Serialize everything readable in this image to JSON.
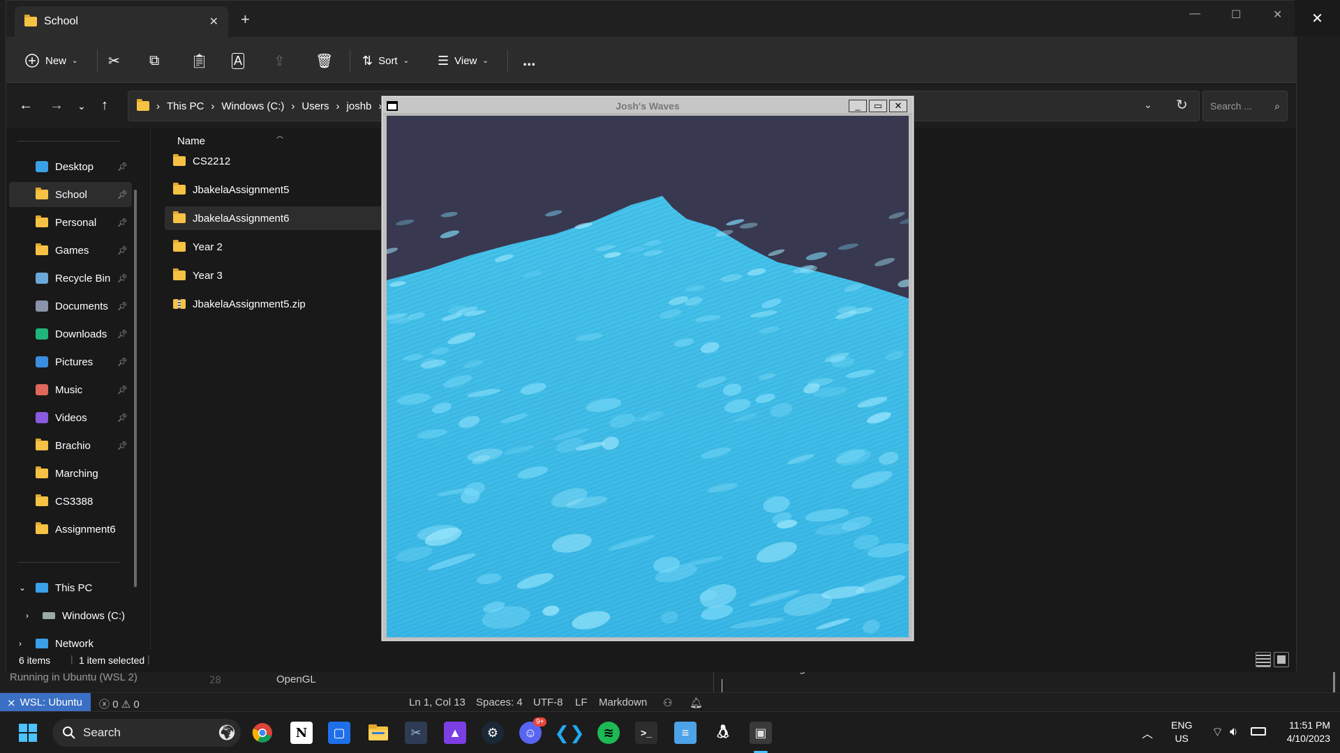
{
  "explorer": {
    "tab_title": "School",
    "toolbar": {
      "new_label": "New",
      "sort_label": "Sort",
      "view_label": "View",
      "more_label": "..."
    },
    "breadcrumb": [
      "This PC",
      "Windows (C:)",
      "Users",
      "joshb"
    ],
    "search_placeholder": "Search ...",
    "nav_items": [
      {
        "label": "Desktop",
        "icon": "desktop-icon",
        "pinned": true
      },
      {
        "label": "School",
        "icon": "folder-icon",
        "pinned": true,
        "selected": true
      },
      {
        "label": "Personal",
        "icon": "folder-icon",
        "pinned": true
      },
      {
        "label": "Games",
        "icon": "folder-icon",
        "pinned": true
      },
      {
        "label": "Recycle Bin",
        "icon": "recycle-bin-icon",
        "pinned": true
      },
      {
        "label": "Documents",
        "icon": "documents-icon",
        "pinned": true
      },
      {
        "label": "Downloads",
        "icon": "downloads-icon",
        "pinned": true
      },
      {
        "label": "Pictures",
        "icon": "pictures-icon",
        "pinned": true
      },
      {
        "label": "Music",
        "icon": "music-icon",
        "pinned": true
      },
      {
        "label": "Videos",
        "icon": "videos-icon",
        "pinned": true
      },
      {
        "label": "Brachio",
        "icon": "folder-icon",
        "pinned": true
      },
      {
        "label": "Marching",
        "icon": "folder-icon",
        "pinned": false
      },
      {
        "label": "CS3388",
        "icon": "folder-icon",
        "pinned": false
      },
      {
        "label": "Assignment6",
        "icon": "folder-icon",
        "pinned": false
      }
    ],
    "tree": {
      "this_pc": "This PC",
      "windows_c": "Windows (C:)",
      "network": "Network"
    },
    "column_name": "Name",
    "files": [
      {
        "name": "CS2212",
        "type": "folder"
      },
      {
        "name": "JbakelaAssignment5",
        "type": "folder"
      },
      {
        "name": "JbakelaAssignment6",
        "type": "folder",
        "selected": true
      },
      {
        "name": "Year 2",
        "type": "folder"
      },
      {
        "name": "Year 3",
        "type": "folder"
      },
      {
        "name": "JbakelaAssignment5.zip",
        "type": "zip"
      }
    ],
    "status": {
      "items": "6 items",
      "selected": "1 item selected"
    }
  },
  "gl_window": {
    "title": "Josh's Waves",
    "colors": {
      "sky": "#383850",
      "water": "#3ab4e2"
    }
  },
  "vscode": {
    "running_in": "Running in Ubuntu (WSL 2)",
    "line_number": "28",
    "code_line": "OpenGL",
    "terminal_text": "Done reading!",
    "status": {
      "wsl": "WSL: Ubuntu",
      "errors": "0",
      "warnings": "0",
      "position": "Ln 1, Col 13",
      "spaces": "Spaces: 4",
      "encoding": "UTF-8",
      "eol": "LF",
      "language": "Markdown"
    }
  },
  "taskbar": {
    "search_label": "Search",
    "discord_badge": "9+",
    "lang_top": "ENG",
    "lang_bottom": "US",
    "time": "11:51 PM",
    "date": "4/10/2023"
  }
}
